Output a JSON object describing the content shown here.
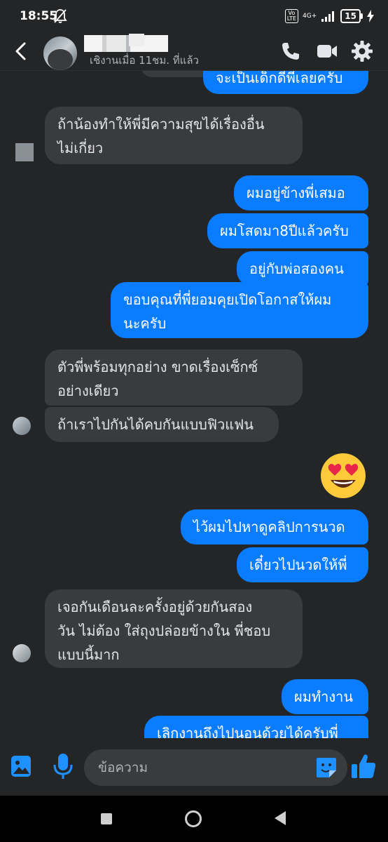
{
  "status_bar": {
    "time": "18:55",
    "volte_label": "Vo\nLTE",
    "network_label": "4G+",
    "battery_level": "15"
  },
  "header": {
    "last_active": "เชิงานเมื่อ 11ชม. ที่แล้ว"
  },
  "messages": [
    {
      "from": "me",
      "text": "จะเป็นเด็กดีพี่เลยครับ"
    },
    {
      "from": "them",
      "text": "ถ้าน้องทำให้พี่มีความสุขได้เรื่องอื่น\nไม่เกี่ยว"
    },
    {
      "from": "me",
      "text": "ผมอยู่ข้างพี่เสมอ"
    },
    {
      "from": "me",
      "text": "ผมโสดมา8ปีแล้วครับ"
    },
    {
      "from": "me",
      "text": "อยู่กับพ่อสองคน"
    },
    {
      "from": "me",
      "text": "ขอบคุณที่พี่ยอมคุยเปิดโอกาสให้ผม\nนะครับ"
    },
    {
      "from": "them",
      "text": "ตัวพี่พร้อมทุกอย่าง ขาดเรื่องเซ็กซ์\nอย่างเดียว"
    },
    {
      "from": "them",
      "text": "ถ้าเราไปกันได้คบกันแบบฟิวแฟน"
    },
    {
      "from": "me",
      "emoji": "heart-eyes"
    },
    {
      "from": "me",
      "text": "ไว้ผมไปหาดูคลิปการนวด"
    },
    {
      "from": "me",
      "text": "เดี๋ยวไปนวดให้พี่"
    },
    {
      "from": "them",
      "text": "เจอกันเดือนละครั้งอยู่ด้วยกันสอง\nวัน ไม่ต้อง ใส่ถุงปล่อยข้างใน พี่ชอบ\nแบบนี้มาก"
    },
    {
      "from": "me",
      "text": "ผมทำงาน"
    },
    {
      "from": "me",
      "text": "เลิกงานถึงไปนอนด้วยได้ครับพี่"
    }
  ],
  "composer": {
    "placeholder": "ข้อความ"
  },
  "colors": {
    "background": "#242526",
    "incoming_bubble": "#3a3b3c",
    "outgoing_bubble": "#0a7cff",
    "accent": "#1e90ff"
  }
}
